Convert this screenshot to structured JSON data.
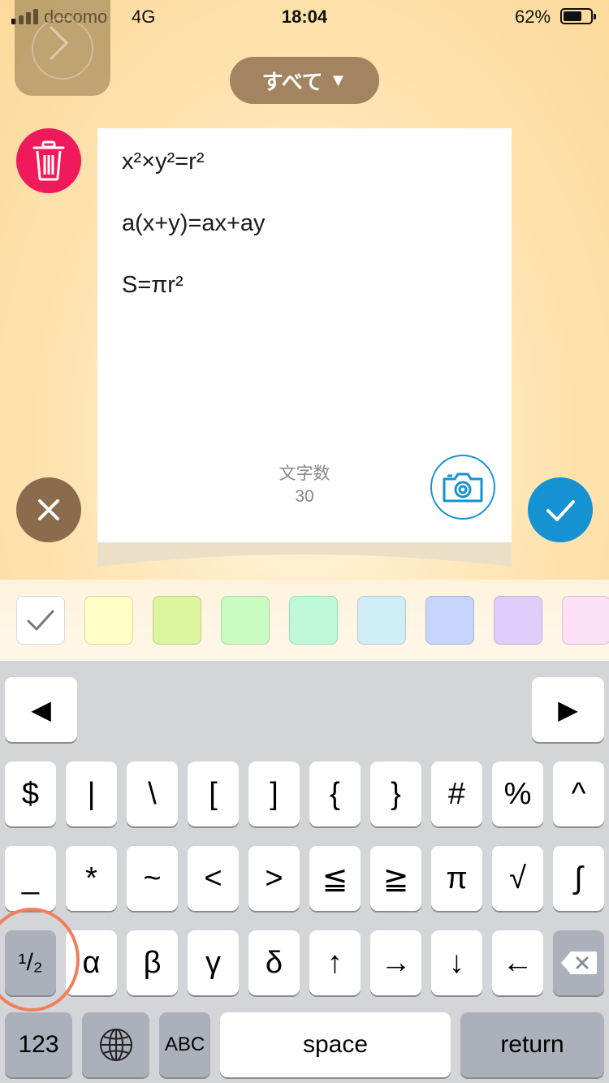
{
  "status_bar": {
    "carrier": "docomo",
    "network": "4G",
    "time": "18:04",
    "battery_percent": "62%"
  },
  "header": {
    "category_label": "すべて",
    "category_arrow": "▼"
  },
  "note": {
    "lines": [
      "x²×y²=r²",
      "a(x+y)=ax+ay",
      "S=πr²"
    ],
    "char_count_label": "文字数",
    "char_count": "30"
  },
  "icons": {
    "forward": "chevron-right-icon",
    "delete": "trash-icon",
    "close": "close-icon",
    "confirm": "check-icon",
    "camera": "camera-icon",
    "globe": "globe-icon",
    "backspace": "backspace-icon"
  },
  "colors": {
    "delete_button": "#f0195c",
    "close_button": "#8a6b4e",
    "confirm_button": "#1592d2",
    "category_pill": "#a28460",
    "highlight_ring": "#f07f5e"
  },
  "swatches": [
    {
      "color": "#ffffff",
      "selected": true
    },
    {
      "color": "#ffffc6",
      "selected": false
    },
    {
      "color": "#ddf59d",
      "selected": false
    },
    {
      "color": "#c9fbc3",
      "selected": false
    },
    {
      "color": "#bdf9d9",
      "selected": false
    },
    {
      "color": "#d0eef6",
      "selected": false
    },
    {
      "color": "#c7d4fb",
      "selected": false
    },
    {
      "color": "#e1cdfb",
      "selected": false
    },
    {
      "color": "#fde0f4",
      "selected": false
    }
  ],
  "keyboard": {
    "cursor_left": "◀",
    "cursor_right": "▶",
    "row1": [
      "$",
      "|",
      "\\",
      "[",
      "]",
      "{",
      "}",
      "#",
      "%",
      "^"
    ],
    "row2": [
      "_",
      "*",
      "~",
      "<",
      ">",
      "≦",
      "≧",
      "π",
      "√",
      "∫"
    ],
    "fraction_key": "¹/₂",
    "row3": [
      "α",
      "β",
      "γ",
      "δ",
      "↑",
      "→",
      "↓",
      "←"
    ],
    "mode_123": "123",
    "abc": "ABC",
    "space": "space",
    "return": "return"
  }
}
